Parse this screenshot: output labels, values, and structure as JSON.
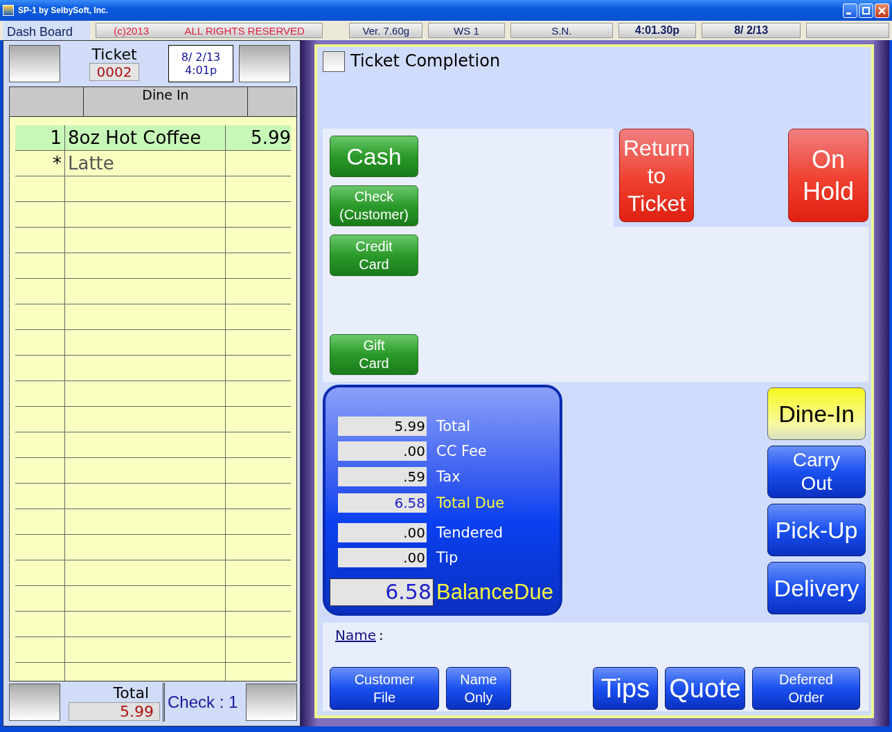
{
  "window": {
    "title": "SP-1 by SelbySoft, Inc."
  },
  "status_bar": {
    "tab": "Dash Board",
    "copyright": "(c)2013",
    "rights": "ALL RIGHTS RESERVED",
    "version": "Ver. 7.60g",
    "workstation": "WS  1",
    "serial": "S.N.",
    "time": "4:01.30p",
    "date": "8/ 2/13"
  },
  "ticket": {
    "label": "Ticket",
    "number": "0002",
    "date": "8/ 2/13",
    "time": "4:01p",
    "order_type": "Dine In",
    "items": [
      {
        "qty": "1",
        "name": "8oz Hot Coffee",
        "price": "5.99",
        "selected": true
      },
      {
        "qty": "*",
        "name": "Latte",
        "selected": false
      }
    ],
    "total_label": "Total",
    "total": "5.99",
    "check": "Check : 1"
  },
  "dialog": {
    "title": "Ticket Completion",
    "checked": false,
    "payments": [
      {
        "label": "Cash",
        "kind": "large"
      },
      {
        "label": "Check\n(Customer)",
        "kind": "small"
      },
      {
        "label": "Credit\nCard",
        "kind": "small"
      },
      {
        "label": "Gift\nCard",
        "kind": "small"
      }
    ],
    "actions": [
      "Return\nto\nTicket",
      "On\nHold"
    ],
    "totals": [
      {
        "value": "5.99",
        "label": "Total",
        "kind": "normal"
      },
      {
        "value": ".00",
        "label": "CC Fee",
        "kind": "normal"
      },
      {
        "value": ".59",
        "label": "Tax",
        "kind": "normal"
      },
      {
        "value": "6.58",
        "label": "Total Due",
        "kind": "due"
      },
      {
        "value": ".00",
        "label": "Tendered",
        "kind": "normal"
      },
      {
        "value": ".00",
        "label": "Tip",
        "kind": "normal"
      }
    ],
    "balance": {
      "value": "6.58",
      "label": "BalanceDue"
    },
    "order_types": [
      {
        "label": "Dine-In",
        "selected": true
      },
      {
        "label": "Carry\nOut",
        "selected": false
      },
      {
        "label": "Pick-Up",
        "selected": false
      },
      {
        "label": "Delivery",
        "selected": false
      }
    ],
    "name_label": "Name",
    "name_colon": ":",
    "buttons": [
      {
        "label": "Customer\nFile",
        "kind": "small"
      },
      {
        "label": "Name\nOnly",
        "kind": "small"
      },
      {
        "label": "Tips",
        "kind": "large"
      },
      {
        "label": "Quote",
        "kind": "large"
      },
      {
        "label": "Deferred\nOrder",
        "kind": "small"
      }
    ]
  }
}
